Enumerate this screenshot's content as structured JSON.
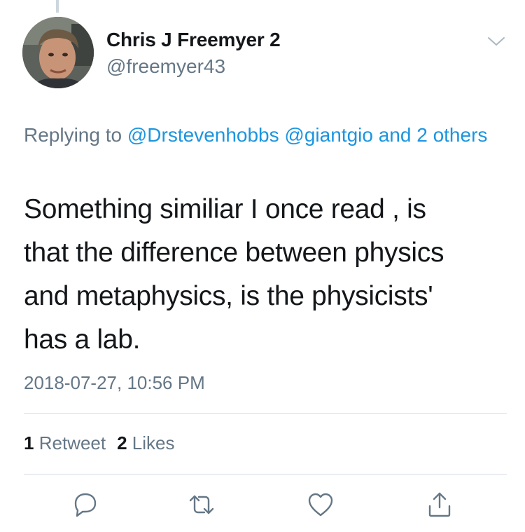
{
  "tweet": {
    "author": {
      "display_name": "Chris J Freemyer 2",
      "handle": "@freemyer43"
    },
    "reply": {
      "prefix": "Replying to ",
      "mentions": [
        "@Drstevenhobbs",
        "@giantgio"
      ],
      "others": "and 2 others"
    },
    "text_lines": [
      "Something similiar I once read , is",
      "that the difference between physics",
      "and metaphysics, is the physicists'",
      "has a lab."
    ],
    "timestamp": "2018-07-27, 10:56 PM",
    "stats": {
      "retweets_count": "1",
      "retweets_label": "Retweet",
      "likes_count": "2",
      "likes_label": "Likes"
    }
  },
  "actions": [
    "reply-icon",
    "retweet-icon",
    "like-icon",
    "share-icon"
  ],
  "colors": {
    "link": "#1b95e0",
    "secondary_text": "#657786",
    "primary_text": "#14171a",
    "divider": "#d8dfe4"
  }
}
